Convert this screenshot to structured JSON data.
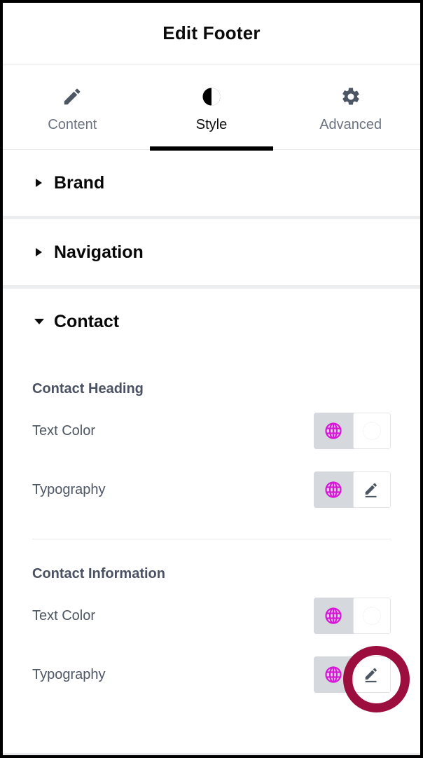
{
  "header": {
    "title": "Edit Footer"
  },
  "tabs": [
    {
      "label": "Content",
      "icon": "pencil-icon",
      "active": false
    },
    {
      "label": "Style",
      "icon": "contrast-icon",
      "active": true
    },
    {
      "label": "Advanced",
      "icon": "gear-icon",
      "active": false
    }
  ],
  "sections": [
    {
      "title": "Brand",
      "expanded": false
    },
    {
      "title": "Navigation",
      "expanded": false
    },
    {
      "title": "Contact",
      "expanded": true
    }
  ],
  "contact": {
    "groups": [
      {
        "heading": "Contact Heading",
        "controls": [
          {
            "label": "Text Color",
            "type": "color",
            "globe_icon": "globe-icon",
            "value": ""
          },
          {
            "label": "Typography",
            "type": "typography",
            "globe_icon": "globe-icon",
            "edit_icon": "pencil-edit-icon"
          }
        ]
      },
      {
        "heading": "Contact Information",
        "controls": [
          {
            "label": "Text Color",
            "type": "color",
            "globe_icon": "globe-icon",
            "value": ""
          },
          {
            "label": "Typography",
            "type": "typography",
            "globe_icon": "globe-icon",
            "edit_icon": "pencil-edit-icon"
          }
        ]
      }
    ]
  },
  "annotation": {
    "target": "contact-information-typography-edit-button",
    "color": "#9b0e3e",
    "shape": "circle"
  },
  "colors": {
    "accent_globe": "#d817d8",
    "active_tab": "#000000",
    "label_text": "#4d5663",
    "heading_text": "#4a5160",
    "section_divider": "#ebedef",
    "control_bg": "#d5d8dd"
  }
}
